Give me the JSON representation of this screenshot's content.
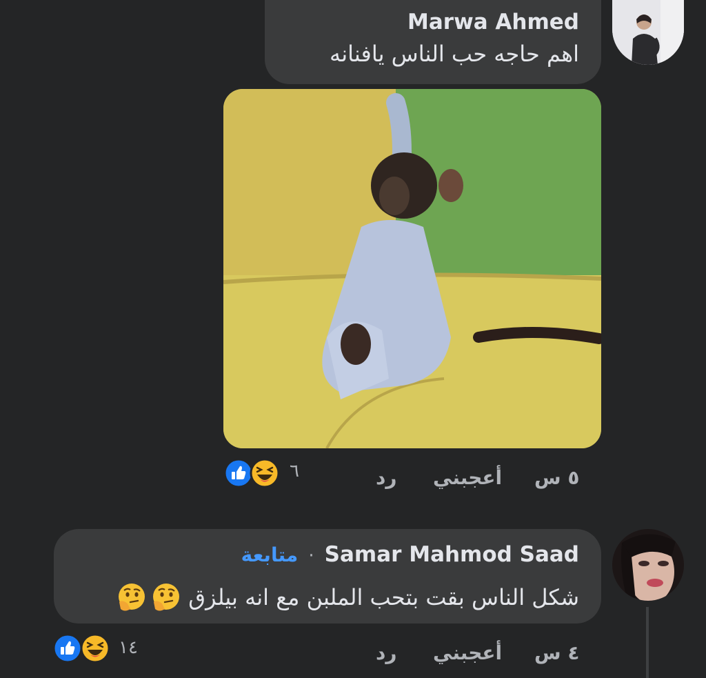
{
  "comments": [
    {
      "author": "Marwa Ahmed",
      "text": "اهم حاجه حب الناس يافنانه",
      "time": "٥ س",
      "like_label": "أعجبني",
      "reply_label": "رد",
      "reaction_count": "٦",
      "reactions": [
        "like-icon",
        "haha-icon"
      ],
      "attachment": "sticker-image"
    },
    {
      "author": "Samar Mahmod Saad",
      "separator": "·",
      "follow_label": "متابعة",
      "text": "شكل الناس بقت بتحب الملبن مع انه بيلزق",
      "text_emojis": [
        "thinking-face-icon",
        "thinking-face-icon"
      ],
      "time": "٤ س",
      "like_label": "أعجبني",
      "reply_label": "رد",
      "reaction_count": "١٤",
      "reactions": [
        "like-icon",
        "haha-icon"
      ]
    }
  ],
  "colors": {
    "background": "#242526",
    "bubble": "#3a3b3c",
    "text": "#e4e6eb",
    "secondary": "#b0b3b8",
    "link": "#4599ff",
    "like_blue": "#1877f2",
    "haha_yellow": "#f7b928"
  }
}
